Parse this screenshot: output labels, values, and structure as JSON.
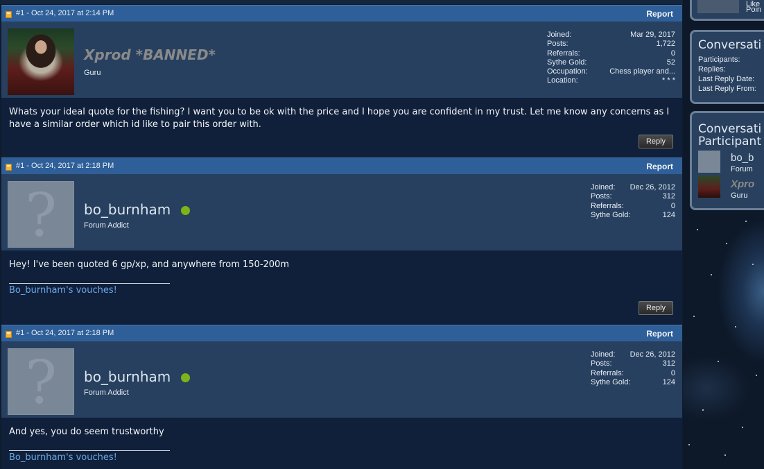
{
  "posts": [
    {
      "date": "#1 - Oct 24, 2017 at 2:14 PM",
      "report": "Report",
      "username": "Xprod *BANNED*",
      "user_title": "Guru",
      "stats": [
        {
          "label": "Joined:",
          "value": "Mar 29, 2017"
        },
        {
          "label": "Posts:",
          "value": "1,722"
        },
        {
          "label": "Referrals:",
          "value": "0"
        },
        {
          "label": "Sythe Gold:",
          "value": "52"
        },
        {
          "label": "Occupation:",
          "value": "Chess player and..."
        },
        {
          "label": "Location:",
          "value": "* * *"
        }
      ],
      "message": "Whats your ideal quote for the fishing? I want you to be ok with the price and I hope you are confident in my trust. Let me know any concerns as I have a similar order which id like to pair this order with.",
      "reply": "Reply"
    },
    {
      "date": "#1 - Oct 24, 2017 at 2:18 PM",
      "report": "Report",
      "username": "bo_burnham",
      "user_title": "Forum Addict",
      "stats": [
        {
          "label": "Joined:",
          "value": "Dec 26, 2012"
        },
        {
          "label": "Posts:",
          "value": "312"
        },
        {
          "label": "Referrals:",
          "value": "0"
        },
        {
          "label": "Sythe Gold:",
          "value": "124"
        }
      ],
      "message": "Hey! I've been quoted 6 gp/xp, and anywhere from 150-200m",
      "signature": "Bo_burnham's vouches!",
      "reply": "Reply"
    },
    {
      "date": "#1 - Oct 24, 2017 at 2:18 PM",
      "report": "Report",
      "username": "bo_burnham",
      "user_title": "Forum Addict",
      "stats": [
        {
          "label": "Joined:",
          "value": "Dec 26, 2012"
        },
        {
          "label": "Posts:",
          "value": "312"
        },
        {
          "label": "Referrals:",
          "value": "0"
        },
        {
          "label": "Sythe Gold:",
          "value": "124"
        }
      ],
      "message": "And yes, you do seem trustworthy",
      "signature": "Bo_burnham's vouches!"
    }
  ],
  "sidebar": {
    "top_box": {
      "line1": "Like",
      "line2": "Poin"
    },
    "info_box": {
      "title": "Conversati",
      "labels": [
        "Participants:",
        "Replies:",
        "Last Reply Date:",
        "Last Reply From:"
      ]
    },
    "participants_box": {
      "title_line1": "Conversati",
      "title_line2": "Participant",
      "participants": [
        {
          "name": "bo_b",
          "title": "Forum"
        },
        {
          "name": "Xpro",
          "title": "Guru"
        }
      ]
    }
  },
  "colors": {
    "header_blue": "#2f5f98",
    "user_bg": "#27405f",
    "body_bg": "#10203a",
    "link": "#6aa6e8",
    "online": "#7cb518"
  }
}
